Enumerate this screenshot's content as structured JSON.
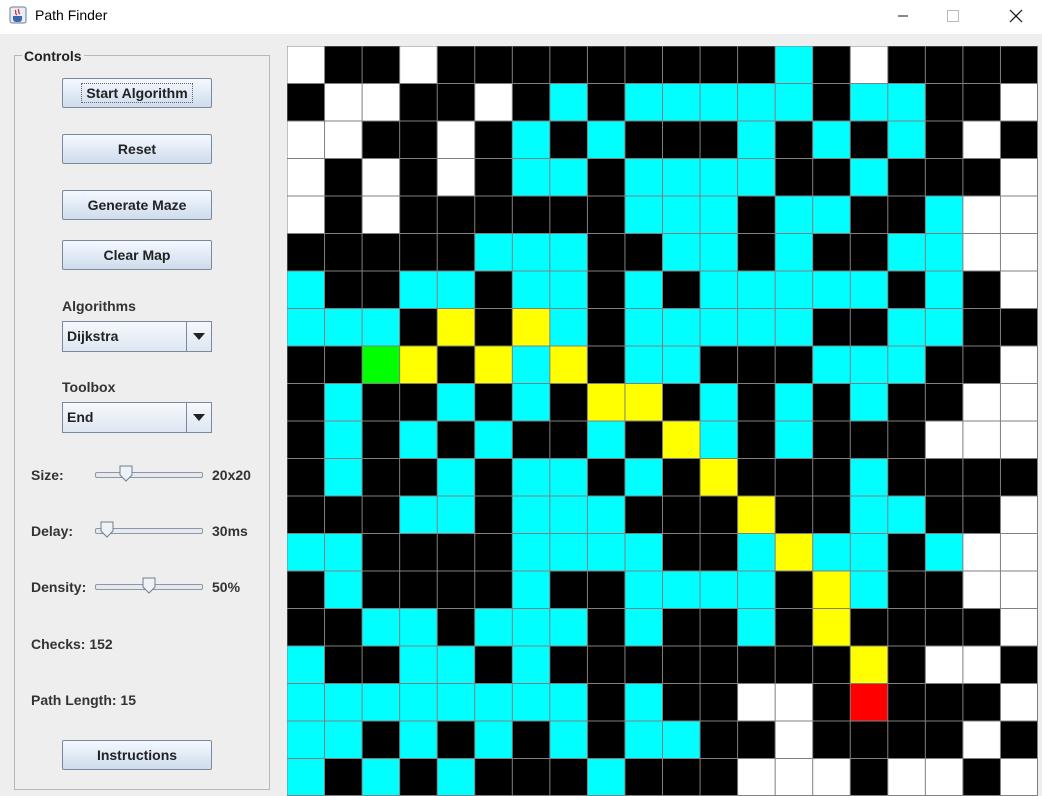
{
  "window": {
    "title": "Path Finder"
  },
  "controls": {
    "panel_title": "Controls",
    "buttons": {
      "start": "Start Algorithm",
      "reset": "Reset",
      "generate": "Generate Maze",
      "clear": "Clear Map",
      "instructions": "Instructions"
    },
    "algorithms": {
      "label": "Algorithms",
      "selected": "Dijkstra"
    },
    "toolbox": {
      "label": "Toolbox",
      "selected": "End"
    },
    "size": {
      "label": "Size:",
      "value_text": "20x20",
      "level": 0.25
    },
    "delay": {
      "label": "Delay:",
      "value_text": "30ms",
      "level": 0.05
    },
    "density": {
      "label": "Density:",
      "value_text": "50%",
      "level": 0.5
    },
    "checks": "Checks: 152",
    "path_length": "Path Length: 15"
  },
  "grid": {
    "cols": 20,
    "rows": 20,
    "legend": {
      "W": "wall",
      "O": "open",
      "C": "checked",
      "P": "path",
      "S": "start",
      "E": "end"
    },
    "colors": {
      "W": "#000000",
      "O": "#ffffff",
      "C": "#00ffff",
      "P": "#ffff00",
      "S": "#00ff00",
      "E": "#ff0000",
      "line": "#808080"
    },
    "cells": [
      "OWWOWWWWWWWWWCWOWWWW",
      "WOOWWOWCWCCCCCWCCWWO",
      "OOWWOWCWCWWWCWCWCWOW",
      "OWOWOWCCWCCCCWWCWWWO",
      "OWOWWWWWWCCCWCCWWCOO",
      "WWWWWCCCWWCCWCWWCCOO",
      "CWWCCWCCWCWCCCCCWCWO",
      "CCCWPWPCWCCCCCWWCCWW",
      "WWSPWPCPWCCWWWCCCWWO",
      "WCWWCWCWPPWCWCWCWWOO",
      "WCWCWCWWCWPCWCWWWOOO",
      "WCWWCWCCWCWPWWWCWWWW",
      "WWWCCWCCCWWWPWWCCWWO",
      "CCWWWWCCCCWWCPCCWCOO",
      "WCWWWWCWWCCCCWPCWWOO",
      "WWCCWCCCWCWWCWPWWWWO",
      "CWWCCWCWWWWWWWWPWOOW",
      "CCCCCCCCWCWWOOWEWWWO",
      "CCWCWCWCWCCWWOWWWWOW",
      "CWCWCWWWCWWWOOOWOOWO"
    ]
  }
}
